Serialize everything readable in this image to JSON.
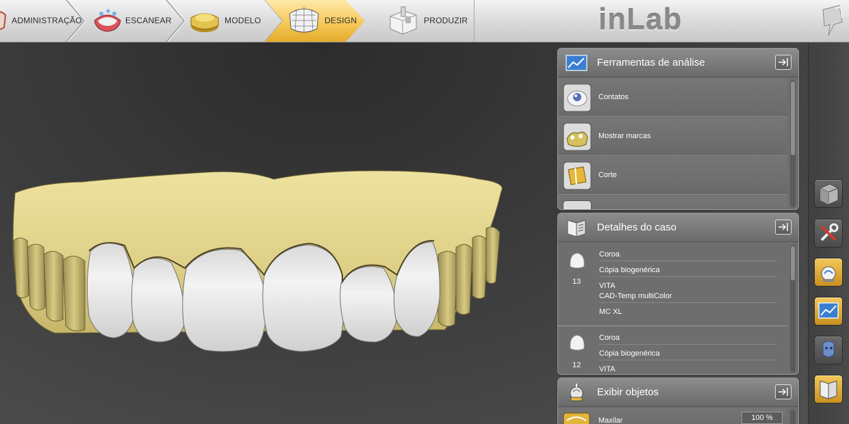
{
  "app": {
    "brand": "inLab"
  },
  "workflow": {
    "steps": [
      {
        "label": "ADMINISTRAÇÃO",
        "icon": "administration-icon",
        "active": false
      },
      {
        "label": "ESCANEAR",
        "icon": "scan-icon",
        "active": false
      },
      {
        "label": "MODELO",
        "icon": "model-icon",
        "active": false
      },
      {
        "label": "DESIGN",
        "icon": "design-icon",
        "active": true
      },
      {
        "label": "PRODUZIR",
        "icon": "produce-icon",
        "active": false
      }
    ],
    "active_color": "#f5c653"
  },
  "analysis_panel": {
    "title": "Ferramentas de análise",
    "icon": "analysis-tools-icon",
    "tools": [
      {
        "label": "Contatos",
        "icon": "contacts-icon"
      },
      {
        "label": "Mostrar marcas",
        "icon": "show-marks-icon"
      },
      {
        "label": "Corte",
        "icon": "cut-icon"
      }
    ]
  },
  "case_panel": {
    "title": "Detalhes do caso",
    "icon": "case-details-icon",
    "items": [
      {
        "tooth": "13",
        "type": "Coroa",
        "method": "Cópia biogenérica",
        "manufacturer": "VITA",
        "material": "CAD-Temp multiColor",
        "block": "MC XL"
      },
      {
        "tooth": "12",
        "type": "Coroa",
        "method": "Cópia biogenérica",
        "manufacturer": "VITA"
      }
    ]
  },
  "objects_panel": {
    "title": "Exibir objetos",
    "icon": "show-objects-icon",
    "items": [
      {
        "label": "Maxilar",
        "value": "100 %"
      }
    ]
  },
  "sidebar": {
    "buttons": [
      {
        "icon": "view-cube-icon",
        "active": false
      },
      {
        "icon": "tools-icon",
        "active": false
      },
      {
        "icon": "design-tool-icon",
        "active": true
      },
      {
        "icon": "analysis-tools-icon",
        "active": true
      },
      {
        "icon": "face-icon",
        "active": false
      },
      {
        "icon": "case-details-icon",
        "active": true
      }
    ]
  },
  "colors": {
    "model_gold": "#ddd08a",
    "tooth_white": "#ececec",
    "panel_gray": "#6e6e6e"
  }
}
